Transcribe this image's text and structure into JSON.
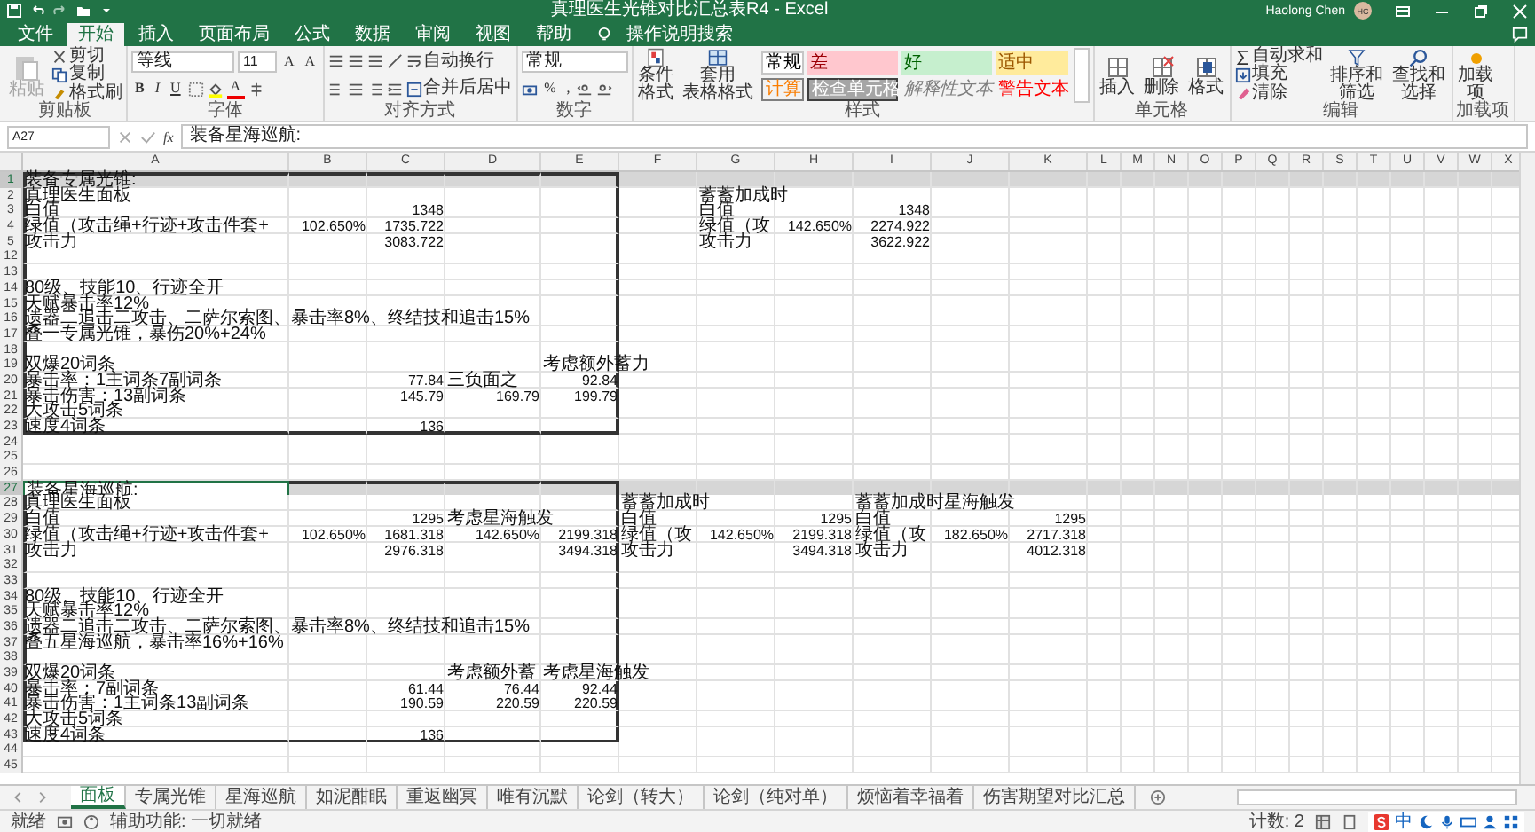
{
  "title_bar": {
    "title": "真理医生光锥对比汇总表R4 - Excel",
    "user": "Haolong Chen",
    "avatar": "HC"
  },
  "menu_tabs": [
    {
      "label": "文件",
      "selected": false
    },
    {
      "label": "开始",
      "selected": true
    },
    {
      "label": "插入",
      "selected": false
    },
    {
      "label": "页面布局",
      "selected": false
    },
    {
      "label": "公式",
      "selected": false
    },
    {
      "label": "数据",
      "selected": false
    },
    {
      "label": "审阅",
      "selected": false
    },
    {
      "label": "视图",
      "selected": false
    },
    {
      "label": "帮助",
      "selected": false
    }
  ],
  "tell_me": "操作说明搜索",
  "ribbon": [
    {
      "kind": "clipboard",
      "label": "剪贴板",
      "paste": {
        "label": "粘贴",
        "disabled": true
      },
      "small": [
        "剪切",
        "复制",
        "格式刷"
      ]
    },
    {
      "kind": "font",
      "label": "字体",
      "font_name": "等线",
      "font_size": "11",
      "size_buttons": [
        "A",
        "A"
      ],
      "styles": [
        "B",
        "I",
        "U"
      ],
      "color_button": "A"
    },
    {
      "kind": "alignment",
      "label": "对齐方式",
      "wrap": "自动换行",
      "merge": "合并后居中"
    },
    {
      "kind": "number",
      "label": "数字",
      "format": "常规",
      "symbols": [
        "%",
        ","
      ]
    },
    {
      "kind": "styles",
      "label": "样式",
      "conditional": "条件格式",
      "table": [
        "套用",
        "表格格式"
      ],
      "swatches": [
        {
          "kind": "normal",
          "label": "常规"
        },
        {
          "kind": "bad",
          "label": "差"
        },
        {
          "kind": "good",
          "label": "好"
        },
        {
          "kind": "neutral",
          "label": "适中"
        },
        {
          "kind": "calc",
          "label": "计算"
        },
        {
          "kind": "check",
          "label": "检查单元格"
        },
        {
          "kind": "explanatory",
          "label": "解释性文本"
        },
        {
          "kind": "warning",
          "label": "警告文本"
        }
      ]
    },
    {
      "kind": "cells",
      "label": "单元格",
      "buttons": [
        "插入",
        "删除",
        "格式"
      ]
    },
    {
      "kind": "editing",
      "label": "编辑",
      "small": [
        "自动求和",
        "填充",
        "清除"
      ],
      "large": [
        "排序和筛选",
        "查找和选择"
      ]
    },
    {
      "kind": "addins",
      "label": "加载项",
      "button": "加载项"
    }
  ],
  "formula_bar": {
    "name_box": "A27",
    "fx": "fx",
    "formula": "装备星海巡航:"
  },
  "columns": [
    "A",
    "B",
    "C",
    "D",
    "E",
    "F",
    "G",
    "H",
    "I",
    "J",
    "K",
    "L",
    "M",
    "N",
    "O",
    "P",
    "Q",
    "R",
    "S",
    "T",
    "U",
    "V",
    "W",
    "X"
  ],
  "rows": [
    {
      "number": "1",
      "selected": true,
      "cells": {
        "A": {
          "kind": "text",
          "text": "装备专属光锥:",
          "active": false
        }
      }
    },
    {
      "number": "2",
      "selected": false,
      "cells": {
        "A": {
          "kind": "text",
          "text": "真理医生面板",
          "active": false
        },
        "G": {
          "kind": "text",
          "text": "蓄蓄加成时",
          "active": false
        }
      }
    },
    {
      "number": "3",
      "selected": false,
      "cells": {
        "A": {
          "kind": "text",
          "text": "白值",
          "active": false
        },
        "C": {
          "kind": "number",
          "text": "1348",
          "active": false
        },
        "G": {
          "kind": "text",
          "text": "白值",
          "active": false
        },
        "I": {
          "kind": "number",
          "text": "1348",
          "active": false
        }
      }
    },
    {
      "number": "4",
      "selected": false,
      "cells": {
        "A": {
          "kind": "text",
          "text": "绿值（攻击绳+行迹+攻击件套+",
          "active": false
        },
        "B": {
          "kind": "number",
          "text": "102.650%",
          "active": false
        },
        "C": {
          "kind": "number",
          "text": "1735.722",
          "active": false
        },
        "G": {
          "kind": "text",
          "text": "绿值（攻",
          "active": false
        },
        "H": {
          "kind": "number",
          "text": "142.650%",
          "active": false
        },
        "I": {
          "kind": "number",
          "text": "2274.922",
          "active": false
        }
      }
    },
    {
      "number": "5",
      "selected": false,
      "cells": {
        "A": {
          "kind": "text",
          "text": "攻击力",
          "active": false
        },
        "C": {
          "kind": "number",
          "text": "3083.722",
          "active": false
        },
        "G": {
          "kind": "text",
          "text": "攻击力",
          "active": false
        },
        "I": {
          "kind": "number",
          "text": "3622.922",
          "active": false
        }
      }
    },
    {
      "number": "12",
      "selected": false,
      "cells": {}
    },
    {
      "number": "13",
      "selected": false,
      "cells": {}
    },
    {
      "number": "14",
      "selected": false,
      "cells": {
        "A": {
          "kind": "text",
          "text": "80级、技能10、行迹全开",
          "active": false
        }
      }
    },
    {
      "number": "15",
      "selected": false,
      "cells": {
        "A": {
          "kind": "text",
          "text": "天赋暴击率12%",
          "active": false
        }
      }
    },
    {
      "number": "16",
      "selected": false,
      "cells": {
        "A": {
          "kind": "text",
          "text": "遗器二追击二攻击、二萨尔索图、暴击率8%、终结技和追击15%",
          "active": false
        }
      }
    },
    {
      "number": "17",
      "selected": false,
      "cells": {
        "A": {
          "kind": "text",
          "text": "叠一专属光锥，暴伤20%+24%",
          "active": false
        }
      }
    },
    {
      "number": "18",
      "selected": false,
      "cells": {}
    },
    {
      "number": "19",
      "selected": false,
      "cells": {
        "A": {
          "kind": "text",
          "text": "双爆20词条",
          "active": false
        },
        "E": {
          "kind": "text",
          "text": "考虑额外蓄力",
          "active": false
        }
      }
    },
    {
      "number": "20",
      "selected": false,
      "cells": {
        "A": {
          "kind": "text",
          "text": "暴击率：1主词条7副词条",
          "active": false
        },
        "C": {
          "kind": "number",
          "text": "77.84",
          "active": false
        },
        "D": {
          "kind": "text",
          "text": "三负面之",
          "active": false
        },
        "E": {
          "kind": "number",
          "text": "92.84",
          "active": false
        }
      }
    },
    {
      "number": "21",
      "selected": false,
      "cells": {
        "A": {
          "kind": "text",
          "text": "暴击伤害：13副词条",
          "active": false
        },
        "C": {
          "kind": "number",
          "text": "145.79",
          "active": false
        },
        "D": {
          "kind": "number",
          "text": "169.79",
          "active": false
        },
        "E": {
          "kind": "number",
          "text": "199.79",
          "active": false
        }
      }
    },
    {
      "number": "22",
      "selected": false,
      "cells": {
        "A": {
          "kind": "text",
          "text": "大攻击5词条",
          "active": false
        }
      }
    },
    {
      "number": "23",
      "selected": false,
      "cells": {
        "A": {
          "kind": "text",
          "text": "速度4词条",
          "active": false
        },
        "C": {
          "kind": "number",
          "text": "136",
          "active": false
        }
      }
    },
    {
      "number": "24",
      "selected": false,
      "cells": {}
    },
    {
      "number": "25",
      "selected": false,
      "cells": {}
    },
    {
      "number": "26",
      "selected": false,
      "cells": {}
    },
    {
      "number": "27",
      "selected": true,
      "cells": {
        "A": {
          "kind": "text",
          "text": "装备星海巡航:",
          "active": true
        }
      }
    },
    {
      "number": "28",
      "selected": false,
      "cells": {
        "A": {
          "kind": "text",
          "text": "真理医生面板",
          "active": false
        },
        "F": {
          "kind": "text",
          "text": "蓄蓄加成时",
          "active": false
        },
        "I": {
          "kind": "text",
          "text": "蓄蓄加成时星海触发",
          "active": false
        }
      }
    },
    {
      "number": "29",
      "selected": false,
      "cells": {
        "A": {
          "kind": "text",
          "text": "白值",
          "active": false
        },
        "C": {
          "kind": "number",
          "text": "1295",
          "active": false
        },
        "D": {
          "kind": "text",
          "text": "考虑星海触发",
          "active": false
        },
        "F": {
          "kind": "text",
          "text": "白值",
          "active": false
        },
        "H": {
          "kind": "number",
          "text": "1295",
          "active": false
        },
        "I": {
          "kind": "text",
          "text": "白值",
          "active": false
        },
        "K": {
          "kind": "number",
          "text": "1295",
          "active": false
        }
      }
    },
    {
      "number": "30",
      "selected": false,
      "cells": {
        "A": {
          "kind": "text",
          "text": "绿值（攻击绳+行迹+攻击件套+",
          "active": false
        },
        "B": {
          "kind": "number",
          "text": "102.650%",
          "active": false
        },
        "C": {
          "kind": "number",
          "text": "1681.318",
          "active": false
        },
        "D": {
          "kind": "number",
          "text": "142.650%",
          "active": false
        },
        "E": {
          "kind": "number",
          "text": "2199.318",
          "active": false
        },
        "F": {
          "kind": "text",
          "text": "绿值（攻",
          "active": false
        },
        "G": {
          "kind": "number",
          "text": "142.650%",
          "active": false
        },
        "H": {
          "kind": "number",
          "text": "2199.318",
          "active": false
        },
        "I": {
          "kind": "text",
          "text": "绿值（攻",
          "active": false
        },
        "J": {
          "kind": "number",
          "text": "182.650%",
          "active": false
        },
        "K": {
          "kind": "number",
          "text": "2717.318",
          "active": false
        }
      }
    },
    {
      "number": "31",
      "selected": false,
      "cells": {
        "A": {
          "kind": "text",
          "text": "攻击力",
          "active": false
        },
        "C": {
          "kind": "number",
          "text": "2976.318",
          "active": false
        },
        "E": {
          "kind": "number",
          "text": "3494.318",
          "active": false
        },
        "F": {
          "kind": "text",
          "text": "攻击力",
          "active": false
        },
        "H": {
          "kind": "number",
          "text": "3494.318",
          "active": false
        },
        "I": {
          "kind": "text",
          "text": "攻击力",
          "active": false
        },
        "K": {
          "kind": "number",
          "text": "4012.318",
          "active": false
        }
      }
    },
    {
      "number": "32",
      "selected": false,
      "cells": {}
    },
    {
      "number": "33",
      "selected": false,
      "cells": {}
    },
    {
      "number": "34",
      "selected": false,
      "cells": {
        "A": {
          "kind": "text",
          "text": "80级、技能10、行迹全开",
          "active": false
        }
      }
    },
    {
      "number": "35",
      "selected": false,
      "cells": {
        "A": {
          "kind": "text",
          "text": "天赋暴击率12%",
          "active": false
        }
      }
    },
    {
      "number": "36",
      "selected": false,
      "cells": {
        "A": {
          "kind": "text",
          "text": "遗器二追击二攻击、二萨尔索图、暴击率8%、终结技和追击15%",
          "active": false
        }
      }
    },
    {
      "number": "37",
      "selected": false,
      "cells": {
        "A": {
          "kind": "text",
          "text": "叠五星海巡航，暴击率16%+16%",
          "active": false
        }
      }
    },
    {
      "number": "38",
      "selected": false,
      "cells": {}
    },
    {
      "number": "39",
      "selected": false,
      "cells": {
        "A": {
          "kind": "text",
          "text": "双爆20词条",
          "active": false
        },
        "D": {
          "kind": "text",
          "text": "考虑额外蓄",
          "active": false
        },
        "E": {
          "kind": "text",
          "text": "考虑星海触发",
          "active": false
        }
      }
    },
    {
      "number": "40",
      "selected": false,
      "cells": {
        "A": {
          "kind": "text",
          "text": "暴击率：7副词条",
          "active": false
        },
        "C": {
          "kind": "number",
          "text": "61.44",
          "active": false
        },
        "D": {
          "kind": "number",
          "text": "76.44",
          "active": false
        },
        "E": {
          "kind": "number",
          "text": "92.44",
          "active": false
        }
      }
    },
    {
      "number": "41",
      "selected": false,
      "cells": {
        "A": {
          "kind": "text",
          "text": "暴击伤害：1主词条13副词条",
          "active": false
        },
        "C": {
          "kind": "number",
          "text": "190.59",
          "active": false
        },
        "D": {
          "kind": "number",
          "text": "220.59",
          "active": false
        },
        "E": {
          "kind": "number",
          "text": "220.59",
          "active": false
        }
      }
    },
    {
      "number": "42",
      "selected": false,
      "cells": {
        "A": {
          "kind": "text",
          "text": "大攻击5词条",
          "active": false
        }
      }
    },
    {
      "number": "43",
      "selected": false,
      "cells": {
        "A": {
          "kind": "text",
          "text": "速度4词条",
          "active": false
        },
        "C": {
          "kind": "number",
          "text": "136",
          "active": false
        }
      }
    },
    {
      "number": "44",
      "selected": false,
      "cells": {}
    },
    {
      "number": "45",
      "selected": false,
      "cells": {}
    }
  ],
  "sheet_tabs": [
    {
      "label": "面板",
      "selected": true
    },
    {
      "label": "专属光锥",
      "selected": false
    },
    {
      "label": "星海巡航",
      "selected": false
    },
    {
      "label": "如泥酣眠",
      "selected": false
    },
    {
      "label": "重返幽冥",
      "selected": false
    },
    {
      "label": "唯有沉默",
      "selected": false
    },
    {
      "label": "论剑（转大）",
      "selected": false
    },
    {
      "label": "论剑（纯对单）",
      "selected": false
    },
    {
      "label": "烦恼着幸福着",
      "selected": false
    },
    {
      "label": "伤害期望对比汇总",
      "selected": false
    }
  ],
  "status_bar": {
    "ready": "就绪",
    "accessibility": "辅助功能: 一切就绪",
    "count": "计数: 2",
    "ime": "中"
  }
}
